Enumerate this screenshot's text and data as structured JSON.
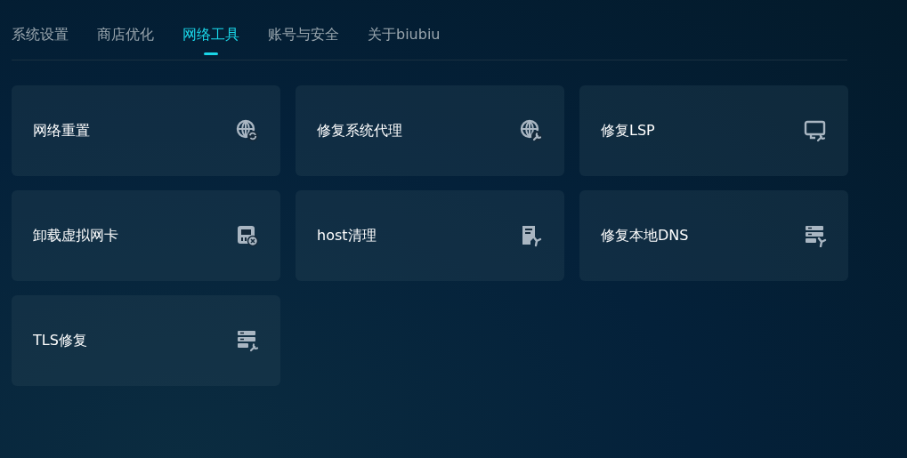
{
  "tabs": [
    {
      "label": "系统设置",
      "selected": false
    },
    {
      "label": "商店优化",
      "selected": false
    },
    {
      "label": "网络工具",
      "selected": true
    },
    {
      "label": "账号与安全",
      "selected": false
    },
    {
      "label": "关于biubiu",
      "selected": false
    }
  ],
  "tools": [
    {
      "label": "网络重置",
      "kind": "globe-refresh"
    },
    {
      "label": "修复系统代理",
      "kind": "globe-wrench"
    },
    {
      "label": "修复LSP",
      "kind": "monitor-wrench"
    },
    {
      "label": "卸载虚拟网卡",
      "kind": "card-remove"
    },
    {
      "label": "host清理",
      "kind": "document-fan"
    },
    {
      "label": "修复本地DNS",
      "kind": "server-fan"
    },
    {
      "label": "TLS修复",
      "kind": "server-wrench"
    }
  ]
}
